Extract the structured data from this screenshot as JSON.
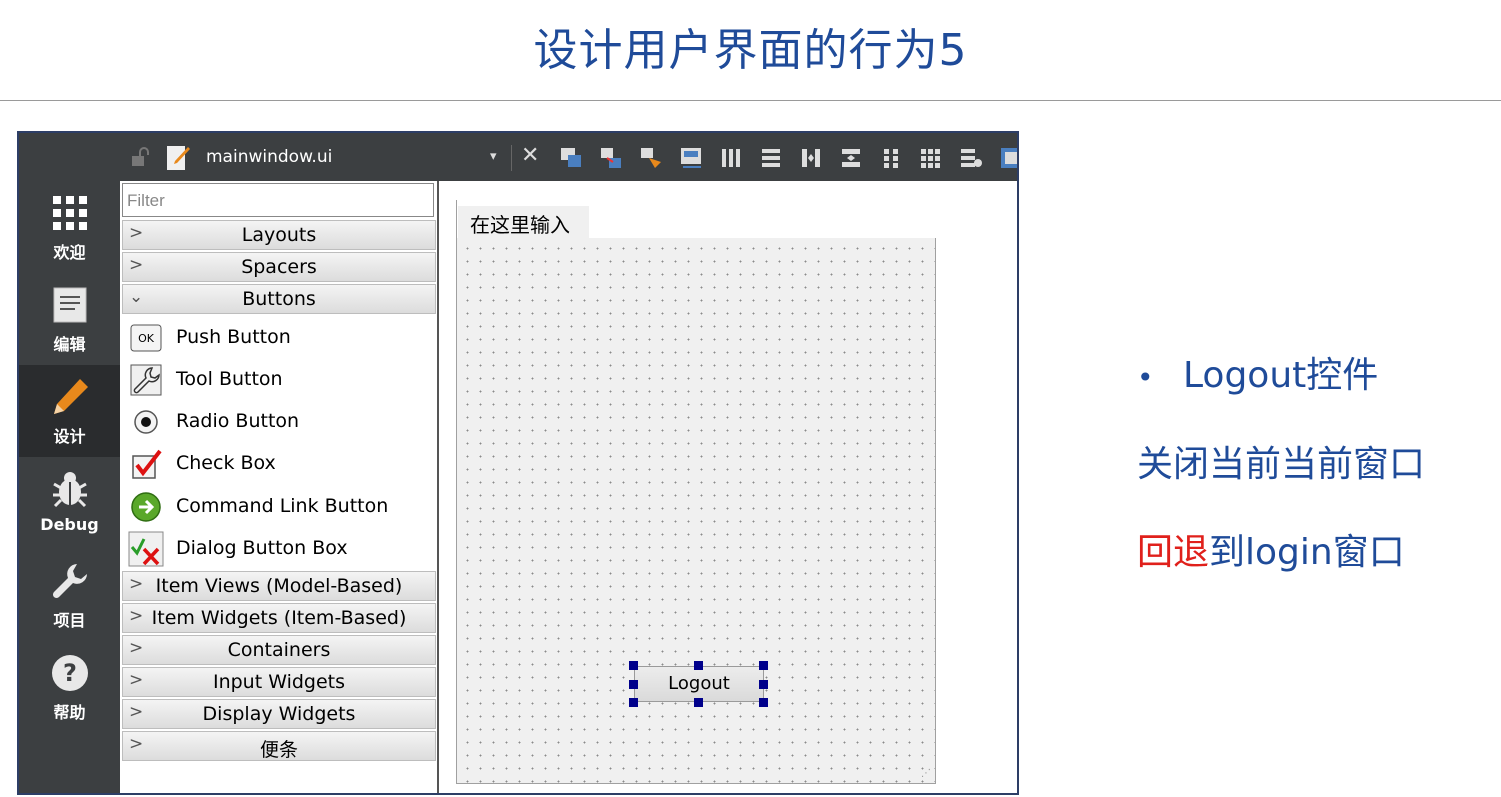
{
  "slide": {
    "title": "设计用户界面的行为5"
  },
  "designer": {
    "toolbar": {
      "filename": "mainwindow.ui",
      "dropdown_glyph": "▾",
      "close_glyph": "✕"
    },
    "modebar": [
      {
        "label": "欢迎",
        "icon": "grid-icon"
      },
      {
        "label": "编辑",
        "icon": "document-icon"
      },
      {
        "label": "设计",
        "icon": "pencil-icon"
      },
      {
        "label": "Debug",
        "icon": "bug-icon"
      },
      {
        "label": "项目",
        "icon": "wrench-icon"
      },
      {
        "label": "帮助",
        "icon": "help-icon"
      }
    ],
    "widgetbox": {
      "filter_placeholder": "Filter",
      "categories_top": [
        "Layouts",
        "Spacers",
        "Buttons"
      ],
      "button_items": [
        {
          "label": "Push Button",
          "icon": "push-button-icon"
        },
        {
          "label": "Tool Button",
          "icon": "tool-button-icon"
        },
        {
          "label": "Radio Button",
          "icon": "radio-button-icon"
        },
        {
          "label": "Check Box",
          "icon": "check-box-icon"
        },
        {
          "label": "Command Link Button",
          "icon": "command-link-icon"
        },
        {
          "label": "Dialog Button Box",
          "icon": "dialog-button-box-icon"
        }
      ],
      "categories_bottom": [
        "Item Views (Model-Based)",
        "Item Widgets (Item-Based)",
        "Containers",
        "Input Widgets",
        "Display Widgets",
        "便条"
      ],
      "ok_icon_text": "OK"
    },
    "form": {
      "menu_placeholder": "在这里输入",
      "button_label": "Logout"
    }
  },
  "notes": {
    "bullet": "•",
    "line1": "Logout控件",
    "line2": "关闭当前当前窗口",
    "line3_red": "回退",
    "line3_rest": "到login窗口"
  },
  "colors": {
    "title": "#1f4b99",
    "accent_red": "#e0201b",
    "designer_dark": "#3c3f41",
    "selection_handle": "#00008b"
  }
}
